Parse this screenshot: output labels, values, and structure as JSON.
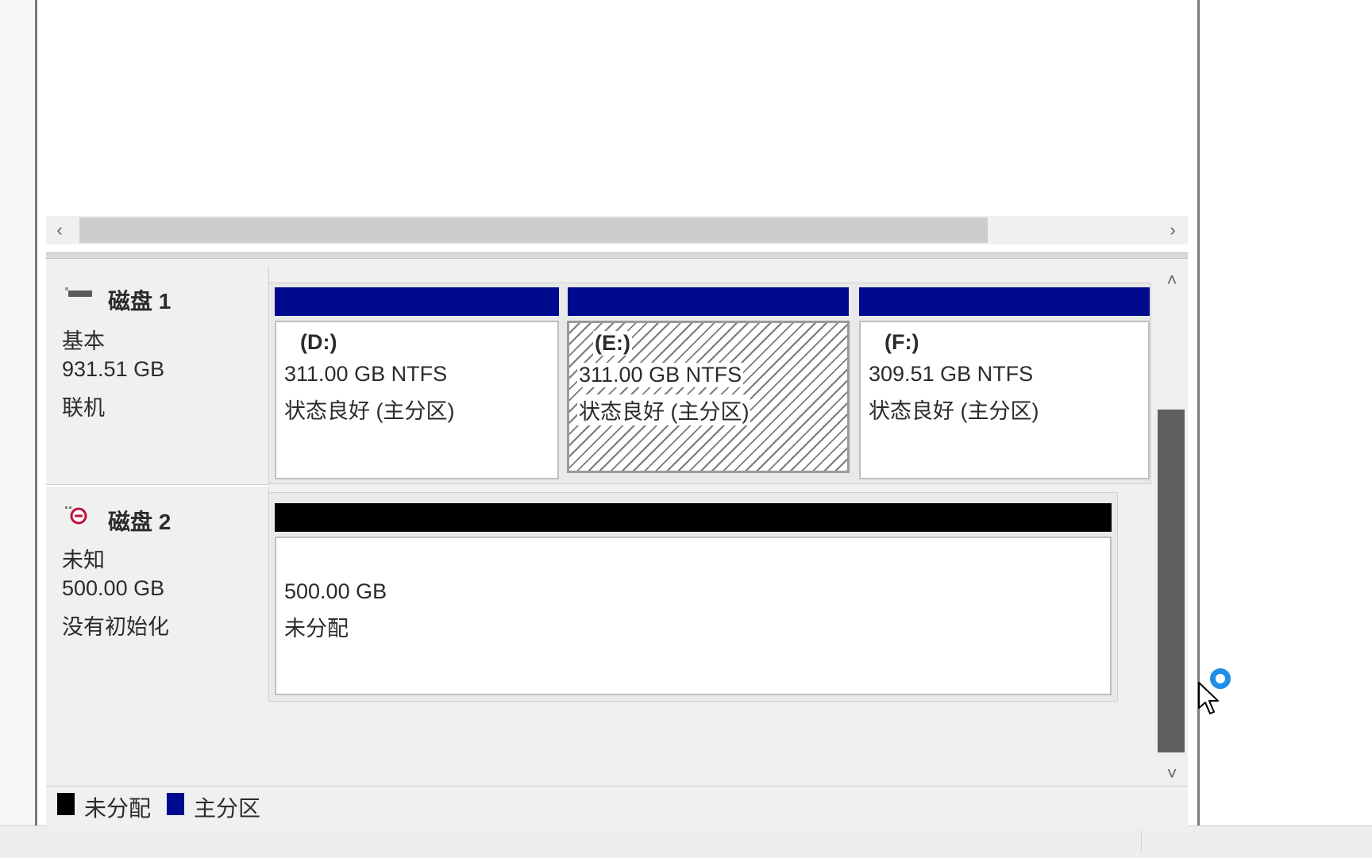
{
  "volume_list": {
    "hscroll_left_glyph": "‹",
    "hscroll_right_glyph": "›"
  },
  "disks": [
    {
      "title": "磁盘 1",
      "icon": "hard-disk-icon",
      "type": "基本",
      "capacity": "931.51 GB",
      "state": "联机",
      "partitions": [
        {
          "name": "(D:)",
          "size_fs": "311.00 GB NTFS",
          "status": "状态良好 (主分区)"
        },
        {
          "name": "(E:)",
          "size_fs": "311.00 GB NTFS",
          "status": "状态良好 (主分区)",
          "selected": true
        },
        {
          "name": "(F:)",
          "size_fs": "309.51 GB NTFS",
          "status": "状态良好 (主分区)"
        }
      ]
    },
    {
      "title": "磁盘 2",
      "icon": "disk-not-initialized-icon",
      "type": "未知",
      "capacity": "500.00 GB",
      "state": "没有初始化",
      "partitions": [
        {
          "size": "500.00 GB",
          "status": "未分配"
        }
      ]
    }
  ],
  "legend": {
    "unallocated": "未分配",
    "primary": "主分区"
  },
  "colors": {
    "primary_partition": "#000a8f",
    "unallocated": "#000000",
    "busy_indicator": "#1e8fe8"
  },
  "vscroll": {
    "up_glyph": "˄",
    "down_glyph": "˅"
  }
}
